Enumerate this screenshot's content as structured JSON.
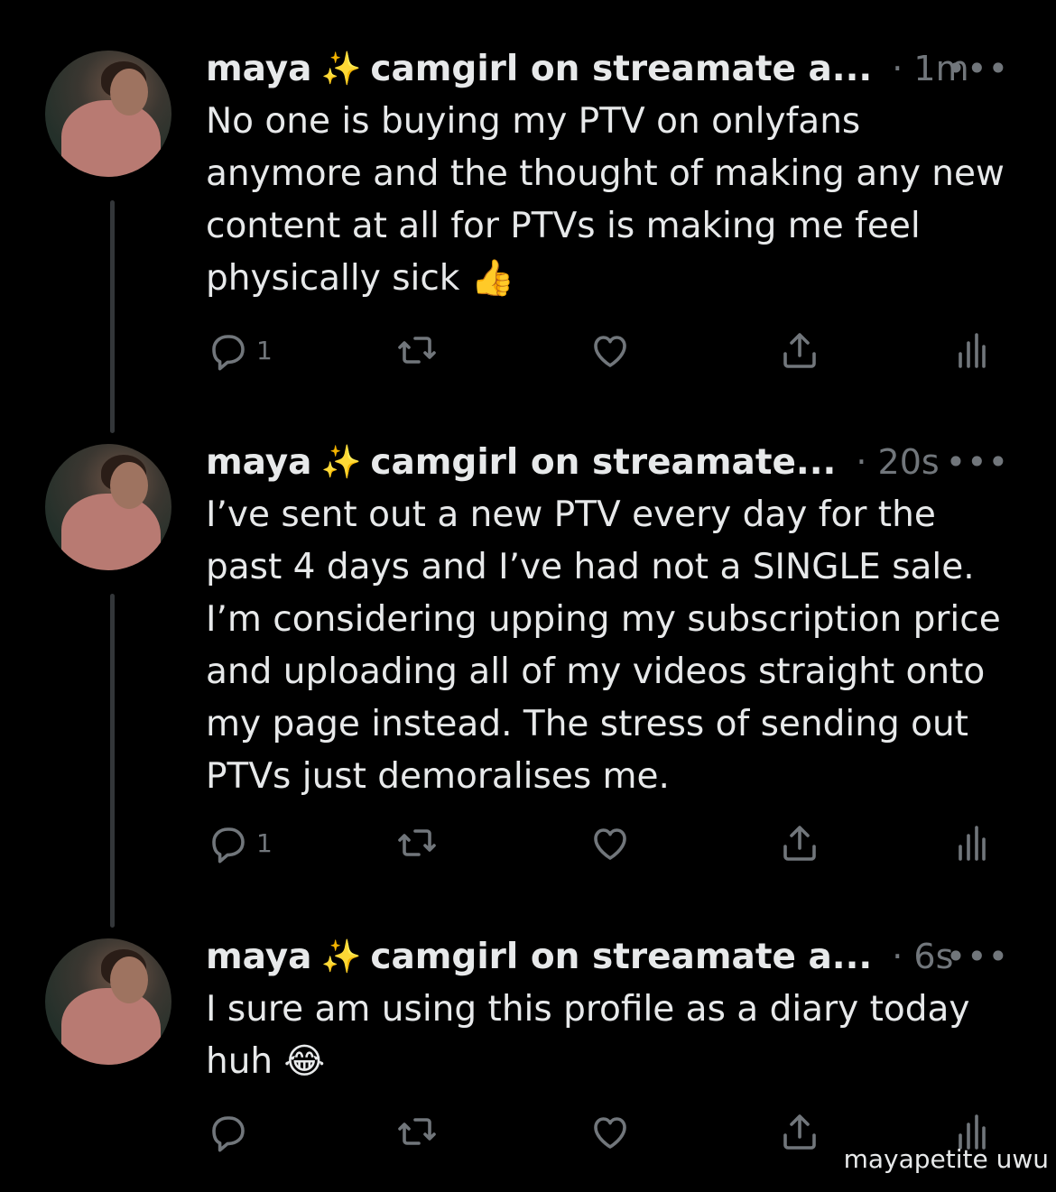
{
  "tweets": [
    {
      "name": "maya",
      "sparkle": "✨",
      "subtitle": "camgirl on streamate a...",
      "time": "· 1m",
      "more": "•••",
      "text": "No one is buying my PTV on onlyfans\nanymore and the thought of making any new\ncontent at all for PTVs is making me feel\nphysically sick 👍",
      "reply_count": "1"
    },
    {
      "name": "maya",
      "sparkle": "✨",
      "subtitle": "camgirl on streamate...",
      "time": "· 20s",
      "more": "•••",
      "text": "I’ve sent out a new PTV every day for the\npast 4 days and I’ve had not a SINGLE sale.\nI’m considering upping my subscription price\nand uploading all of my videos straight onto\nmy page instead. The stress of sending out\nPTVs just demoralises me.",
      "reply_count": "1"
    },
    {
      "name": "maya",
      "sparkle": "✨",
      "subtitle": "camgirl on streamate a...",
      "time": "· 6s",
      "more": "•••",
      "text": "I sure am using this profile as a diary today\nhuh 😂",
      "reply_count": ""
    }
  ],
  "icons": [
    "reply-icon",
    "retweet-icon",
    "like-icon",
    "share-icon",
    "views-icon"
  ],
  "colors": {
    "background": "#000000",
    "text": "#e7e9ea",
    "muted": "#71767b",
    "thread_line": "#333639"
  },
  "watermark": "mayapetite uwu"
}
